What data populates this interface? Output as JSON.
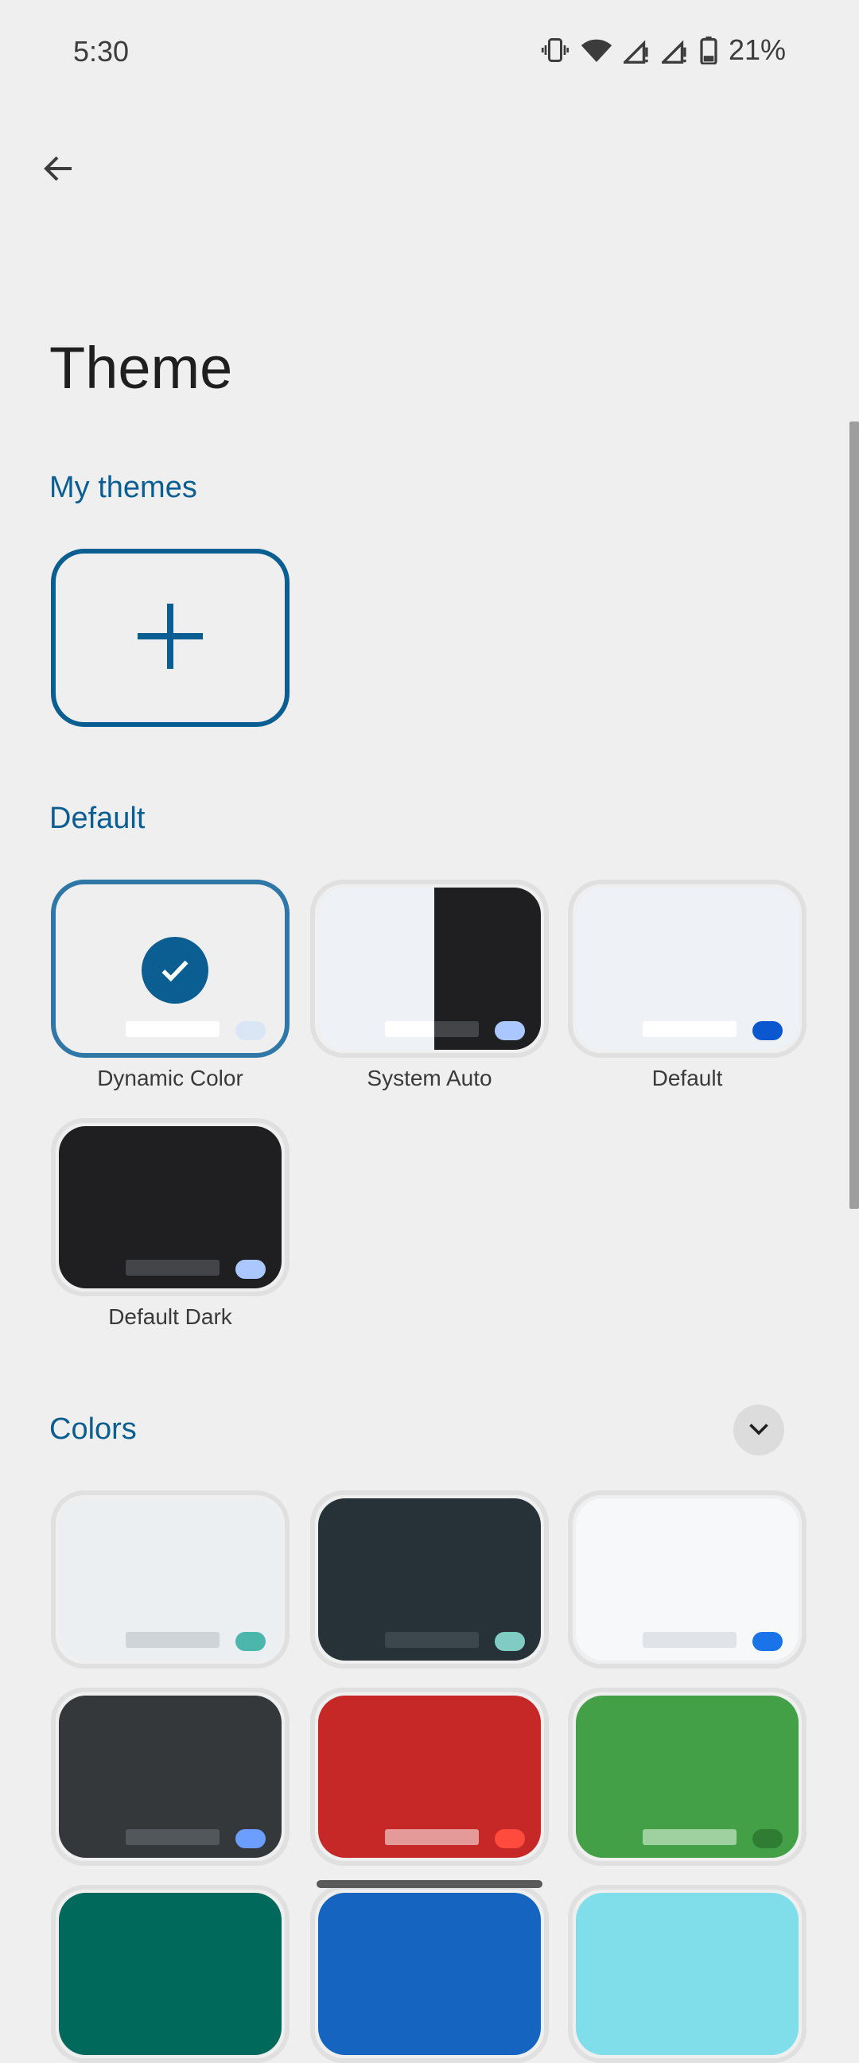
{
  "status": {
    "time": "5:30",
    "battery": "21%"
  },
  "header": {
    "title": "Theme"
  },
  "sections": {
    "my_themes": "My themes",
    "default": "Default",
    "colors": "Colors"
  },
  "default_themes": [
    {
      "label": "Dynamic Color",
      "selected": true
    },
    {
      "label": "System Auto",
      "selected": false
    },
    {
      "label": "Default",
      "selected": false
    },
    {
      "label": "Default Dark",
      "selected": false
    }
  ],
  "colors_swatches": [
    {
      "bg": "#eceff1",
      "bar": "#cfd4d8",
      "pill": "#4db6ac"
    },
    {
      "bg": "#263238",
      "bar": "#3b474d",
      "pill": "#80cbc4"
    },
    {
      "bg": "#f7f8fa",
      "bar": "#e0e3e7",
      "pill": "#1a73e8"
    },
    {
      "bg": "#35383b",
      "bar": "#52575b",
      "pill": "#6b9eff"
    },
    {
      "bg": "#c62828",
      "bar": "#e59a9a",
      "pill": "#ff4b3e"
    },
    {
      "bg": "#43a047",
      "bar": "#9ed0a0",
      "pill": "#2e7d32"
    }
  ],
  "colors": {
    "accent": "#0b5e91",
    "background": "#efefef"
  }
}
